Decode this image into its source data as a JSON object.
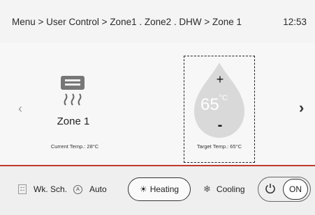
{
  "header": {
    "breadcrumb": "Menu > User Control > Zone1 . Zone2 . DHW > Zone 1",
    "time": "12:53"
  },
  "zone": {
    "name": "Zone 1",
    "current_temp_label": "Current Temp.: 28°C"
  },
  "target": {
    "value": "65",
    "unit": "°C",
    "plus": "+",
    "minus": "-",
    "label": "Target Temp.: 65°C"
  },
  "nav": {
    "prev": "‹",
    "next": "›"
  },
  "footer": {
    "weekly": "Wk. Sch.",
    "auto": "Auto",
    "auto_glyph": "A",
    "heating": "Heating",
    "cooling": "Cooling",
    "on": "ON"
  },
  "colors": {
    "accent_line": "#c0392b",
    "drop": "#d9d9d9"
  },
  "icons": [
    "heater-icon",
    "chevron-left-icon",
    "chevron-right-icon",
    "schedule-icon",
    "auto-icon",
    "sun-icon",
    "snowflake-icon",
    "power-icon"
  ]
}
